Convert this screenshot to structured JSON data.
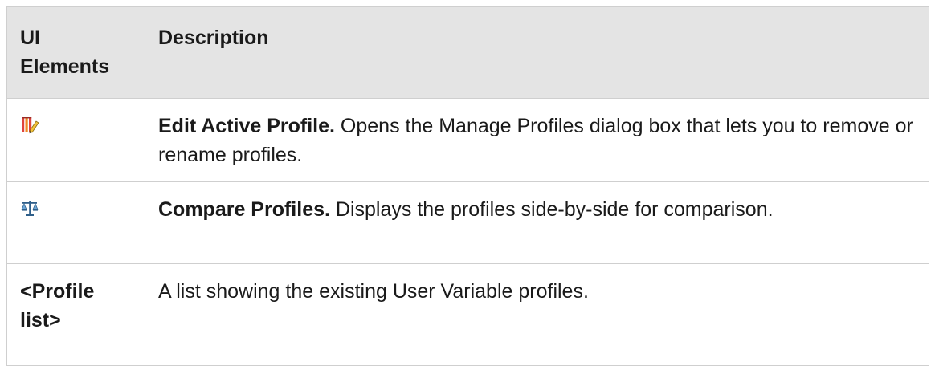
{
  "table": {
    "headers": [
      "UI Elements",
      "Description"
    ],
    "rows": [
      {
        "element_icon": "edit-profile-icon",
        "title": "Edit Active Profile.",
        "description": " Opens the Manage Profiles dialog box that lets you to remove or rename profiles."
      },
      {
        "element_icon": "compare-profiles-icon",
        "title": "Compare Profiles.",
        "description": " Displays the profiles side-by-side for comparison."
      },
      {
        "element_label": "<Profile list>",
        "description": "A list showing the existing User Variable profiles."
      }
    ]
  }
}
